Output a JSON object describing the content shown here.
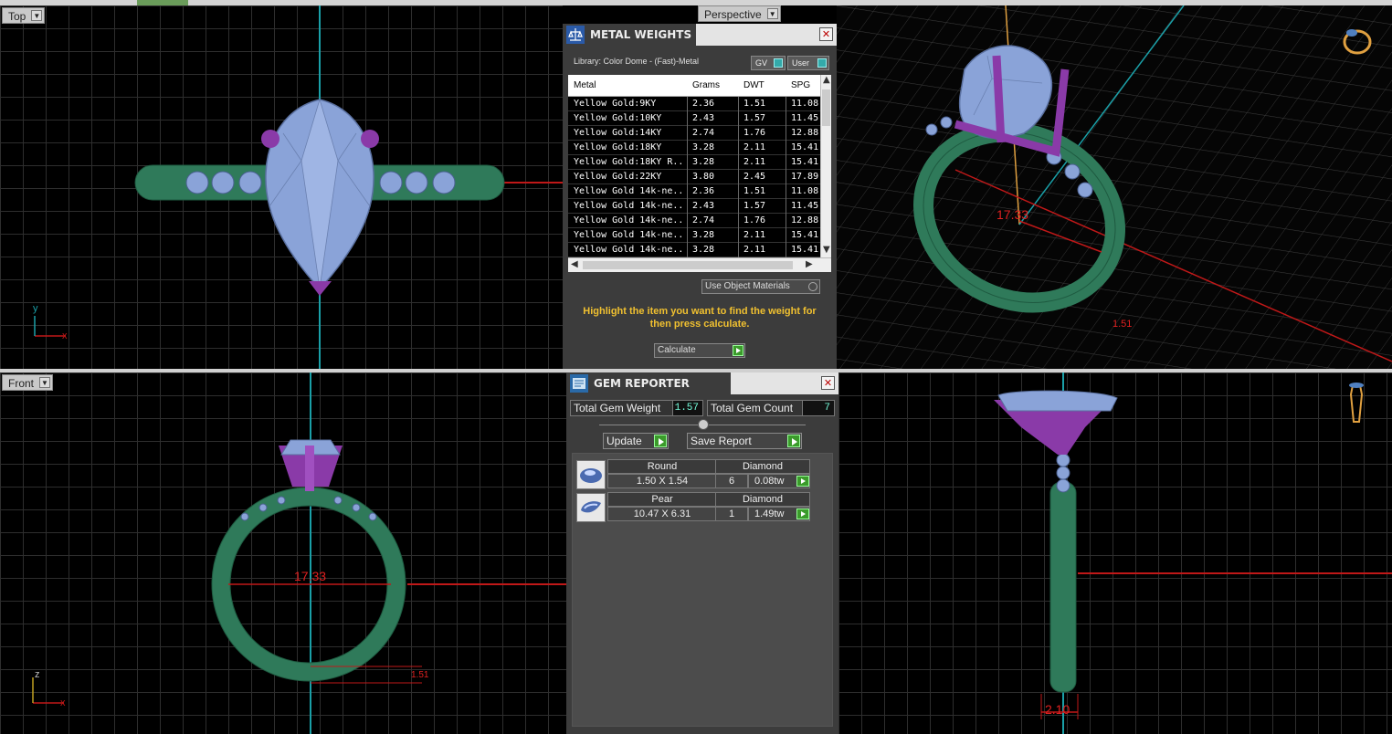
{
  "viewports": {
    "top": {
      "label": "Top"
    },
    "front": {
      "label": "Front"
    },
    "perspective": {
      "label": "Perspective"
    }
  },
  "dimensions": {
    "front_width": "17.33",
    "perspective_width": "17.33",
    "perspective_thickness": "1.51",
    "front_thickness": "1.51",
    "right_width": "2.10"
  },
  "axes": {
    "x": "x",
    "y": "y",
    "z": "z"
  },
  "metal_weights": {
    "title": "METAL WEIGHTS",
    "library": "Library: Color Dome - (Fast)-Metal",
    "gv_label": "GV",
    "user_label": "User",
    "columns": [
      "Metal",
      "Grams",
      "DWT",
      "SPG"
    ],
    "rows": [
      {
        "metal": "Yellow Gold:9KY",
        "grams": "2.36",
        "dwt": "1.51",
        "spg": "11.08"
      },
      {
        "metal": "Yellow Gold:10KY",
        "grams": "2.43",
        "dwt": "1.57",
        "spg": "11.45"
      },
      {
        "metal": "Yellow Gold:14KY",
        "grams": "2.74",
        "dwt": "1.76",
        "spg": "12.88"
      },
      {
        "metal": "Yellow Gold:18KY",
        "grams": "3.28",
        "dwt": "2.11",
        "spg": "15.41"
      },
      {
        "metal": "Yellow Gold:18KY R...",
        "grams": "3.28",
        "dwt": "2.11",
        "spg": "15.41"
      },
      {
        "metal": "Yellow Gold:22KY",
        "grams": "3.80",
        "dwt": "2.45",
        "spg": "17.89"
      },
      {
        "metal": "Yellow Gold 14k-ne...",
        "grams": "2.36",
        "dwt": "1.51",
        "spg": "11.08"
      },
      {
        "metal": "Yellow Gold 14k-ne...",
        "grams": "2.43",
        "dwt": "1.57",
        "spg": "11.45"
      },
      {
        "metal": "Yellow Gold 14k-ne...",
        "grams": "2.74",
        "dwt": "1.76",
        "spg": "12.88"
      },
      {
        "metal": "Yellow Gold 14k-ne...",
        "grams": "3.28",
        "dwt": "2.11",
        "spg": "15.41"
      },
      {
        "metal": "Yellow Gold 14k-ne...",
        "grams": "3.28",
        "dwt": "2.11",
        "spg": "15.41"
      }
    ],
    "use_object_materials": "Use Object Materials",
    "hint": "Highlight the item you want to find the weight for then press calculate.",
    "calculate_label": "Calculate"
  },
  "gem_reporter": {
    "title": "GEM REPORTER",
    "total_weight_label": "Total Gem Weight",
    "total_weight_value": "1.57",
    "total_count_label": "Total Gem Count",
    "total_count_value": "7",
    "update_label": "Update",
    "save_report_label": "Save Report",
    "gems": [
      {
        "shape": "Round",
        "material": "Diamond",
        "size": "1.50 X 1.54",
        "count": "6",
        "weight": "0.08tw"
      },
      {
        "shape": "Pear",
        "material": "Diamond",
        "size": "10.47 X 6.31",
        "count": "1",
        "weight": "1.49tw"
      }
    ]
  },
  "colors": {
    "band": "#2f7a5a",
    "stone": "#8aa3d8",
    "prong": "#8a3aa8",
    "dimension": "#e02020",
    "axis_cyan": "#1aa0a8"
  }
}
